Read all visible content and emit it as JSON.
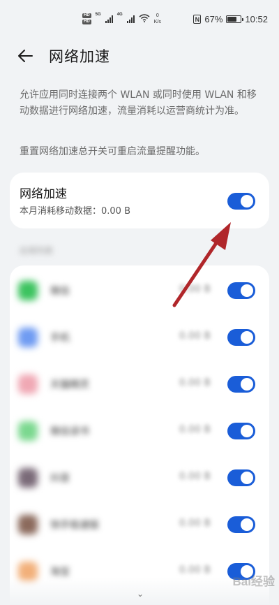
{
  "status_bar": {
    "hd1": "HD",
    "hd2": "HD",
    "net1": "5G",
    "net2": "4G",
    "speed_value": "0",
    "speed_unit": "K/s",
    "battery": "67%",
    "time": "10:52"
  },
  "header": {
    "title": "网络加速"
  },
  "description": {
    "line1": "允许应用同时连接两个 WLAN 或同时使用 WLAN 和移动数据进行网络加速，流量消耗以运营商统计为准。",
    "line2": "重置网络加速总开关可重启流量提醒功能。"
  },
  "main_toggle": {
    "title": "网络加速",
    "subtitle": "本月消耗移动数据：0.00 B",
    "state": "on"
  },
  "apps": {
    "section_label": "应用列表",
    "rows": [
      {
        "name": "微信",
        "usage": "0.00 B",
        "icon_color": "#3cc35f",
        "state": "on"
      },
      {
        "name": "手机",
        "usage": "0.00 B",
        "icon_color": "#6f9bf2",
        "state": "on"
      },
      {
        "name": "天猫精灵",
        "usage": "0.00 B",
        "icon_color": "#f0a8b4",
        "state": "on"
      },
      {
        "name": "微信读书",
        "usage": "0.00 B",
        "icon_color": "#7bd88f",
        "state": "on"
      },
      {
        "name": "抖音",
        "usage": "0.00 B",
        "icon_color": "#7a6a78",
        "state": "on"
      },
      {
        "name": "快手极速版",
        "usage": "0.00 B",
        "icon_color": "#8b6a5c",
        "state": "on"
      },
      {
        "name": "淘宝",
        "usage": "0.00 B",
        "icon_color": "#f2b07a",
        "state": "on"
      }
    ]
  },
  "watermark": "Bai经验",
  "colors": {
    "accent": "#1a5dd8",
    "background": "#f1f3f5",
    "annotation_arrow": "#b0262a"
  }
}
